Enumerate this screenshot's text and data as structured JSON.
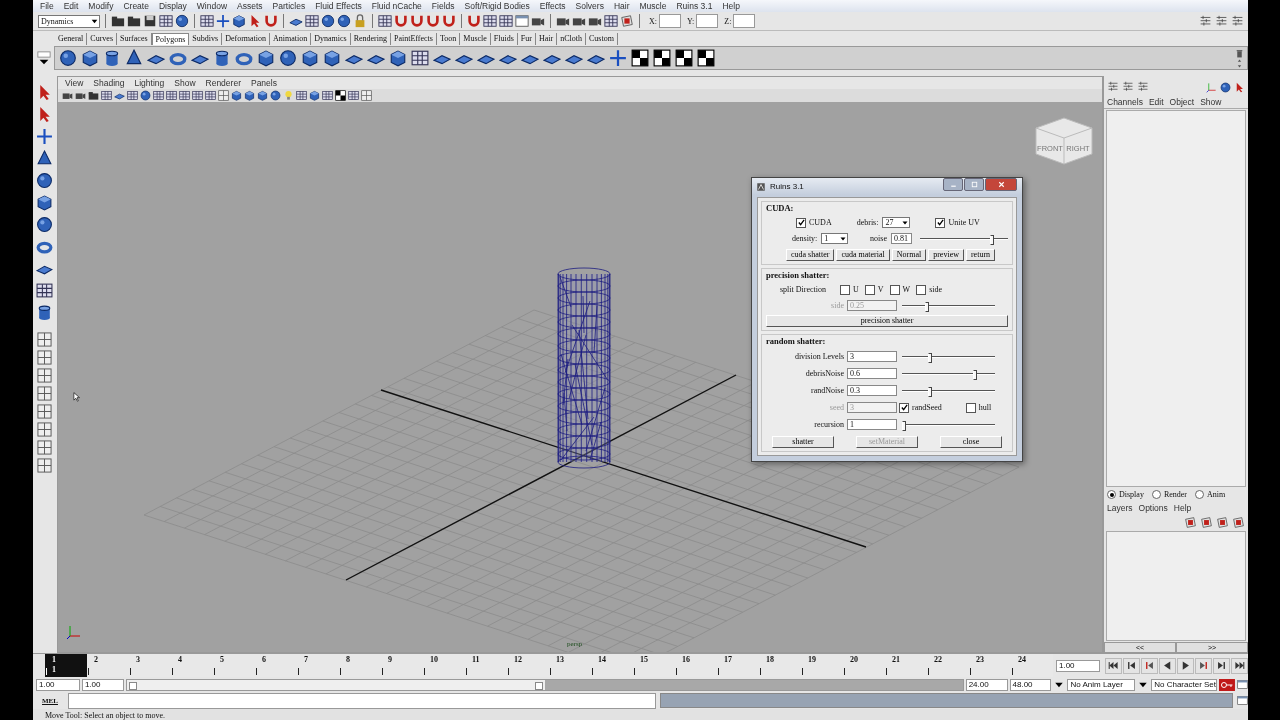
{
  "menubar": [
    "File",
    "Edit",
    "Modify",
    "Create",
    "Display",
    "Window",
    "Assets",
    "Particles",
    "Fluid Effects",
    "Fluid nCache",
    "Fields",
    "Soft/Rigid Bodies",
    "Effects",
    "Solvers",
    "Hair",
    "Muscle",
    "Ruins 3.1",
    "Help"
  ],
  "status_line": {
    "mode": "Dynamics",
    "coordinates": [
      "X:",
      "Y:",
      "Z:"
    ]
  },
  "shelf": {
    "tabs": [
      {
        "label": "General",
        "selected": false
      },
      {
        "label": "Curves",
        "selected": false
      },
      {
        "label": "Surfaces",
        "selected": false
      },
      {
        "label": "Polygons",
        "selected": true
      },
      {
        "label": "Subdivs",
        "selected": false
      },
      {
        "label": "Deformation",
        "selected": false
      },
      {
        "label": "Animation",
        "selected": false
      },
      {
        "label": "Dynamics",
        "selected": false
      },
      {
        "label": "Rendering",
        "selected": false
      },
      {
        "label": "PaintEffects",
        "selected": false
      },
      {
        "label": "Toon",
        "selected": false
      },
      {
        "label": "Muscle",
        "selected": false
      },
      {
        "label": "Fluids",
        "selected": false
      },
      {
        "label": "Fur",
        "selected": false
      },
      {
        "label": "Hair",
        "selected": false
      },
      {
        "label": "nCloth",
        "selected": false
      },
      {
        "label": "Custom",
        "selected": false
      }
    ]
  },
  "panel": {
    "menus": [
      "View",
      "Shading",
      "Lighting",
      "Show",
      "Renderer",
      "Panels"
    ],
    "camera": "persp",
    "view_cube": [
      "FRONT",
      "RIGHT"
    ]
  },
  "dialog": {
    "title": "Ruins 3.1",
    "cuda": {
      "title": "CUDA:",
      "cuda": {
        "label": "CUDA",
        "checked": true
      },
      "debris": {
        "label": "debris:",
        "value": "27"
      },
      "unite_uv": {
        "label": "Unite UV",
        "checked": true
      },
      "density": {
        "label": "density:",
        "value": "1"
      },
      "noise": {
        "label": "noise",
        "value": "0.81",
        "level": 0.82
      },
      "buttons": [
        "cuda shatter",
        "cuda material",
        "Normal",
        "preview",
        "return"
      ]
    },
    "precision": {
      "title": "precision shatter:",
      "split_label": "split Direction",
      "directions": [
        {
          "label": "U",
          "checked": false
        },
        {
          "label": "V",
          "checked": false
        },
        {
          "label": "W",
          "checked": false
        },
        {
          "label": "side",
          "checked": false
        }
      ],
      "side": {
        "label": "side",
        "value": "0.25",
        "level": 0.27,
        "disabled": true
      },
      "button": "precision shatter"
    },
    "random": {
      "title": "random shatter:",
      "fields": [
        {
          "kind": "slider",
          "label": "division Levels",
          "value": "3",
          "level": 0.3
        },
        {
          "kind": "slider",
          "label": "debrisNoise",
          "value": "0.6",
          "level": 0.78
        },
        {
          "kind": "slider",
          "label": "randNoise",
          "value": "0.3",
          "level": 0.3
        },
        {
          "kind": "seed",
          "label": "seed",
          "value": "3",
          "disabled": true,
          "options": [
            {
              "label": "randSeed",
              "checked": true
            },
            {
              "label": "hull",
              "checked": false
            }
          ]
        },
        {
          "kind": "slider",
          "label": "recursion",
          "value": "1",
          "level": 0.02
        }
      ],
      "buttons": [
        {
          "label": "shatter",
          "disabled": false
        },
        {
          "label": "setMaterial",
          "disabled": true
        },
        {
          "label": "close",
          "disabled": false
        }
      ]
    }
  },
  "channel_box": {
    "menus": [
      "Channels",
      "Edit",
      "Object",
      "Show"
    ],
    "layer_modes": [
      {
        "label": "Display",
        "selected": true
      },
      {
        "label": "Render",
        "selected": false
      },
      {
        "label": "Anim",
        "selected": false
      }
    ],
    "layer_menus": [
      "Layers",
      "Options",
      "Help"
    ],
    "nav": [
      "<<",
      ">>"
    ]
  },
  "time_slider": {
    "ticks": [
      {
        "label": "1",
        "selected": true
      },
      {
        "label": "2",
        "selected": false
      },
      {
        "label": "3",
        "selected": false
      },
      {
        "label": "4",
        "selected": false
      },
      {
        "label": "5",
        "selected": false
      },
      {
        "label": "6",
        "selected": false
      },
      {
        "label": "7",
        "selected": false
      },
      {
        "label": "8",
        "selected": false
      },
      {
        "label": "9",
        "selected": false
      },
      {
        "label": "10",
        "selected": false
      },
      {
        "label": "11",
        "selected": false
      },
      {
        "label": "12",
        "selected": false
      },
      {
        "label": "13",
        "selected": false
      },
      {
        "label": "14",
        "selected": false
      },
      {
        "label": "15",
        "selected": false
      },
      {
        "label": "16",
        "selected": false
      },
      {
        "label": "17",
        "selected": false
      },
      {
        "label": "18",
        "selected": false
      },
      {
        "label": "19",
        "selected": false
      },
      {
        "label": "20",
        "selected": false
      },
      {
        "label": "21",
        "selected": false
      },
      {
        "label": "22",
        "selected": false
      },
      {
        "label": "23",
        "selected": false
      },
      {
        "label": "24",
        "selected": false
      }
    ],
    "current_frame": "1",
    "frame_field": "1.00"
  },
  "range_slider": {
    "level": 0.5,
    "start": "1.00",
    "playback_start": "1.00",
    "playback_end": "24.00",
    "end": "48.00",
    "anim_layer": "No Anim Layer",
    "character_set": "No Character Set"
  },
  "command_line": {
    "label": "MEL"
  },
  "help_line": "Move Tool: Select an object to move."
}
